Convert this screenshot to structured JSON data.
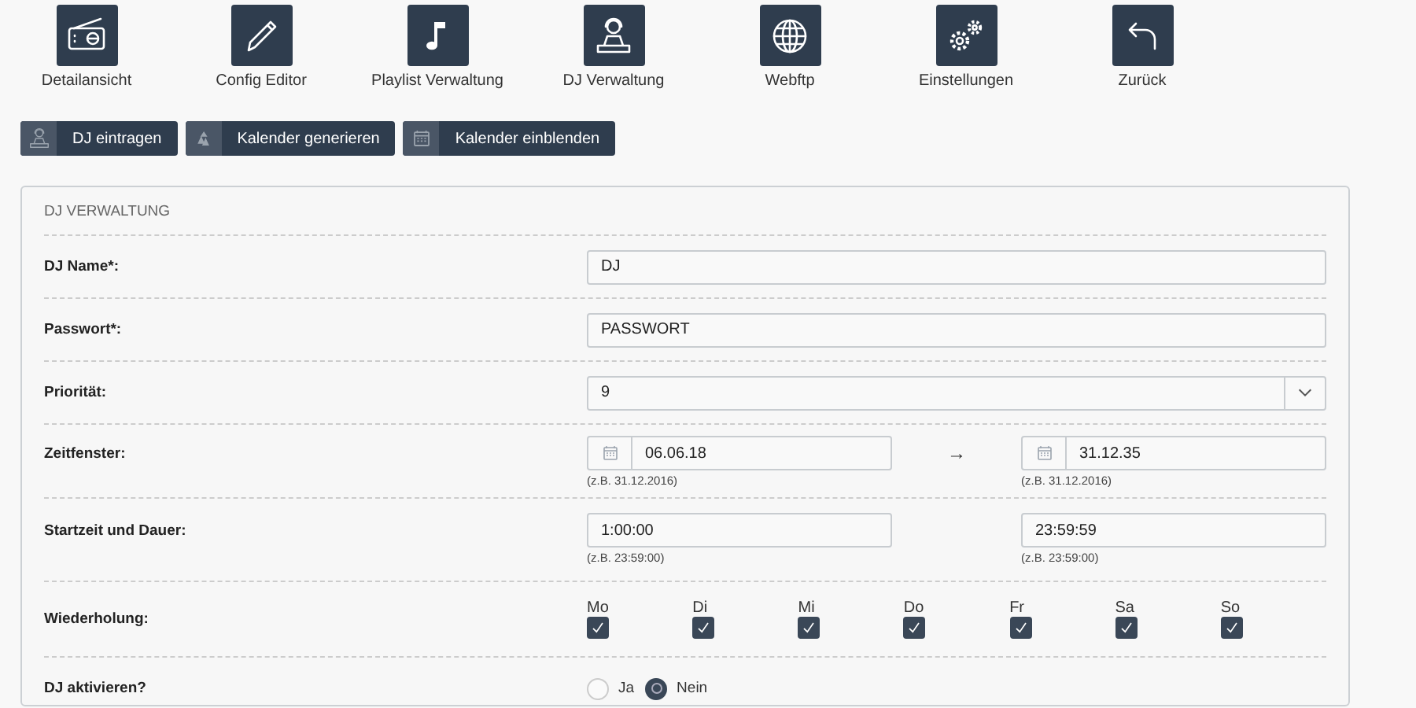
{
  "nav": [
    {
      "label": "Detailansicht"
    },
    {
      "label": "Config Editor"
    },
    {
      "label": "Playlist Verwaltung"
    },
    {
      "label": "DJ Verwaltung"
    },
    {
      "label": "Webftp"
    },
    {
      "label": "Einstellungen"
    },
    {
      "label": "Zurück"
    }
  ],
  "actions": [
    {
      "label": "DJ eintragen"
    },
    {
      "label": "Kalender generieren"
    },
    {
      "label": "Kalender einblenden"
    }
  ],
  "panel": {
    "title": "DJ VERWALTUNG",
    "rows": [
      {
        "kind": "text",
        "label": "DJ Name*:",
        "value": "DJ"
      },
      {
        "kind": "text",
        "label": "Passwort*:",
        "value": "PASSWORT"
      },
      {
        "kind": "select",
        "label": "Priorität:",
        "value": "9"
      },
      {
        "kind": "daterange",
        "label": "Zeitfenster:",
        "separator": "→",
        "from": {
          "value": "06.06.18",
          "hint": "(z.B. 31.12.2016)"
        },
        "to": {
          "value": "31.12.35",
          "hint": "(z.B. 31.12.2016)"
        }
      },
      {
        "kind": "timerange",
        "label": "Startzeit und Dauer:",
        "from": {
          "value": "1:00:00",
          "hint": "(z.B. 23:59:00)"
        },
        "to": {
          "value": "23:59:59",
          "hint": "(z.B. 23:59:00)"
        }
      },
      {
        "kind": "weekdays",
        "label": "Wiederholung:",
        "days": [
          {
            "label": "Mo",
            "checked": true
          },
          {
            "label": "Di",
            "checked": true
          },
          {
            "label": "Mi",
            "checked": true
          },
          {
            "label": "Do",
            "checked": true
          },
          {
            "label": "Fr",
            "checked": true
          },
          {
            "label": "Sa",
            "checked": true
          },
          {
            "label": "So",
            "checked": true
          }
        ]
      },
      {
        "kind": "radio",
        "label": "DJ aktivieren?",
        "options": [
          {
            "label": "Ja",
            "selected": false
          },
          {
            "label": "Nein",
            "selected": true
          }
        ]
      }
    ]
  }
}
